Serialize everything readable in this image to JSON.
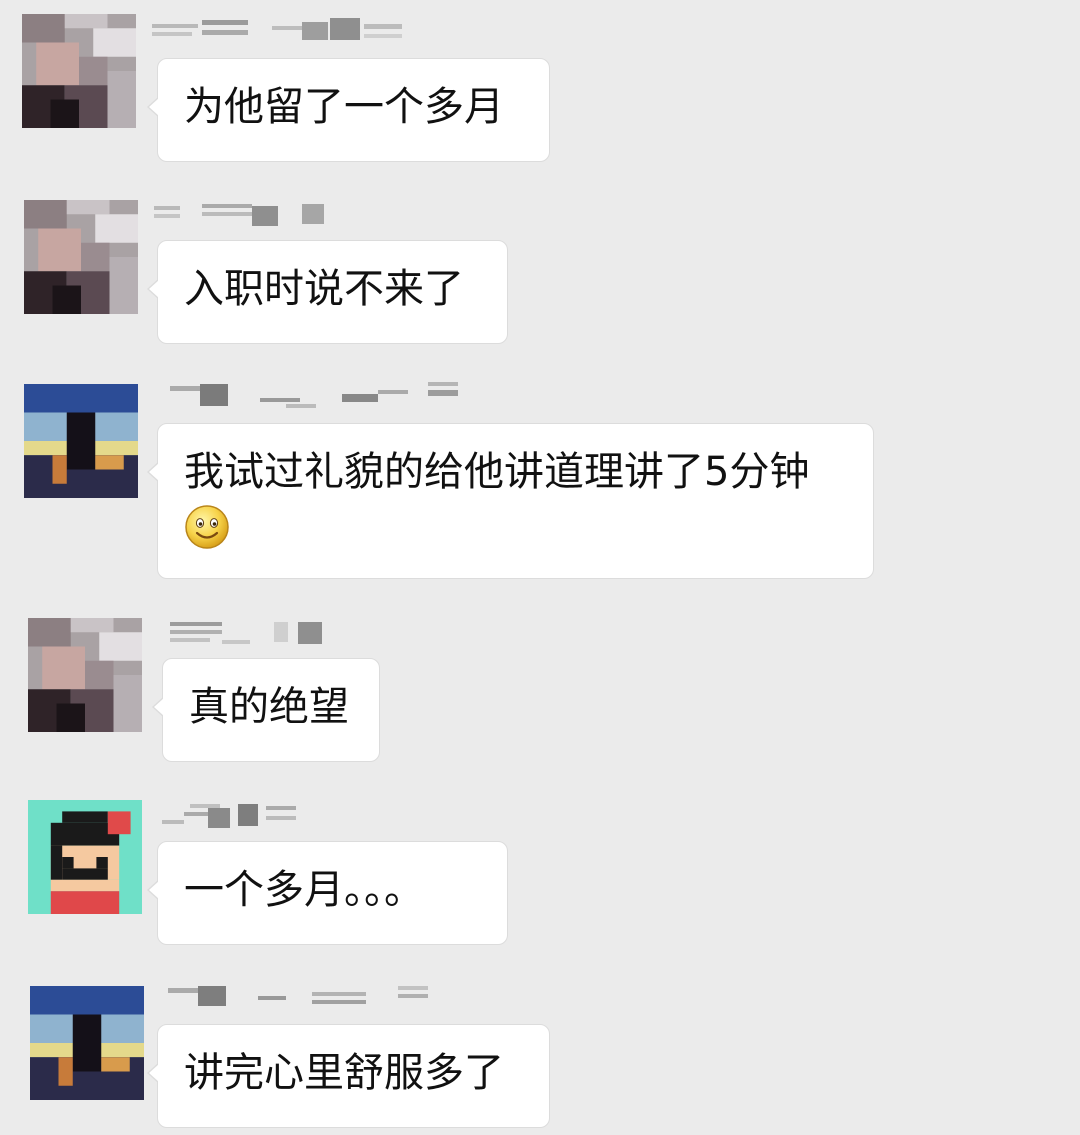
{
  "messages": [
    {
      "text": "为他留了一个多月",
      "avatar": "girl-hair-avatar",
      "nickname": "blurred"
    },
    {
      "text": "入职时说不来了",
      "avatar": "girl-hair-avatar",
      "nickname": "blurred"
    },
    {
      "text": "我试过礼貌的给他讲道理讲了5分钟",
      "emoji": "smiley-face-icon",
      "avatar": "sunset-silhouette-avatar",
      "nickname": "blurred"
    },
    {
      "text": "真的绝望",
      "avatar": "girl-hair-avatar",
      "nickname": "blurred"
    },
    {
      "text": "一个多月。。。",
      "avatar": "cartoon-girl-avatar",
      "nickname": "blurred"
    },
    {
      "text": "讲完心里舒服多了",
      "avatar": "sunset-silhouette-avatar",
      "nickname": "blurred"
    }
  ],
  "colors": {
    "background": "#ebebeb",
    "bubble": "#ffffff",
    "bubble_border": "#dcdcdc",
    "text": "#111111"
  }
}
